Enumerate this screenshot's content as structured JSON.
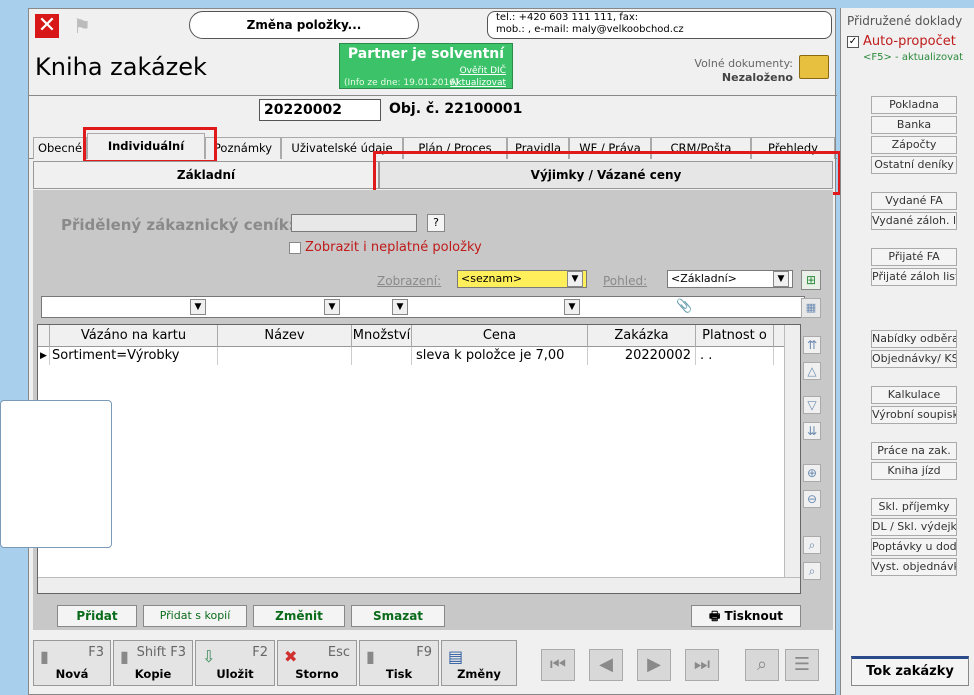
{
  "header": {
    "title": "Kniha zakázek",
    "change_label": "Změna položky...",
    "contact_line1": "tel.: +420 603 111 111, fax:",
    "contact_line2": "mob.: , e-mail: maly@velkoobchod.cz",
    "partner_status": "Partner je solventní",
    "partner_info": "(Info ze dne: 19.01.2016)",
    "verify_dic": "Ověřit DIČ",
    "update": "Aktualizovat",
    "free_docs_label": "Volné dokumenty:",
    "free_docs_value": "Nezaloženo",
    "order_number": "20220002",
    "obj_number": "Obj. č. 22100001"
  },
  "tabs": [
    "Obecné",
    "Individuální",
    "Poznámky",
    "Uživatelské údaje",
    "Plán / Proces",
    "Pravidla",
    "WF / Práva",
    "CRM/Pošta",
    "Přehledy"
  ],
  "subtabs": {
    "basic": "Základní",
    "exceptions": "Výjimky / Vázané ceny"
  },
  "filters": {
    "pricelist_label": "Přidělený zákaznický ceník:",
    "question": "?",
    "show_invalid": "Zobrazit i neplatné položky",
    "display_label": "Zobrazení:",
    "display_value": "<seznam>",
    "view_label": "Pohled:",
    "view_value": "<Základní>"
  },
  "grid": {
    "columns": [
      "Vázáno na kartu",
      "Název",
      "Množství",
      "Cena",
      "Zakázka",
      "Platnost o"
    ],
    "rows": [
      [
        "Sortiment=Výrobky",
        "",
        "",
        "sleva k položce je 7,00",
        "20220002",
        ". ."
      ]
    ]
  },
  "actions": {
    "add": "Přidat",
    "add_copy": "Přidat s kopií",
    "change": "Změnit",
    "delete": "Smazat",
    "print": "Tisknout"
  },
  "toolbar": [
    {
      "key": "F3",
      "label": "Nová"
    },
    {
      "key": "Shift F3",
      "label": "Kopie"
    },
    {
      "key": "F2",
      "label": "Uložit"
    },
    {
      "key": "Esc",
      "label": "Storno"
    },
    {
      "key": "F9",
      "label": "Tisk"
    },
    {
      "key": "",
      "label": "Změny"
    }
  ],
  "side": {
    "title": "Přidružené doklady",
    "auto_label": "Auto-propočet",
    "auto_hint": "<F5> - aktualizovat",
    "items": [
      "Pokladna",
      "Banka",
      "Zápočty",
      "Ostatní deníky",
      "Vydané FA",
      "Vydané záloh. listy",
      "Přijaté FA",
      "Přijaté záloh listy",
      "Nabídky odběrat.",
      "Objednávky/ KS",
      "Kalkulace",
      "Výrobní soupisky",
      "Práce na zak.",
      "Kniha jízd",
      "Skl. příjemky",
      "DL / Skl. výdejky",
      "Poptávky u dod.",
      "Vyst. objednávky"
    ],
    "flow": "Tok zakázky"
  }
}
